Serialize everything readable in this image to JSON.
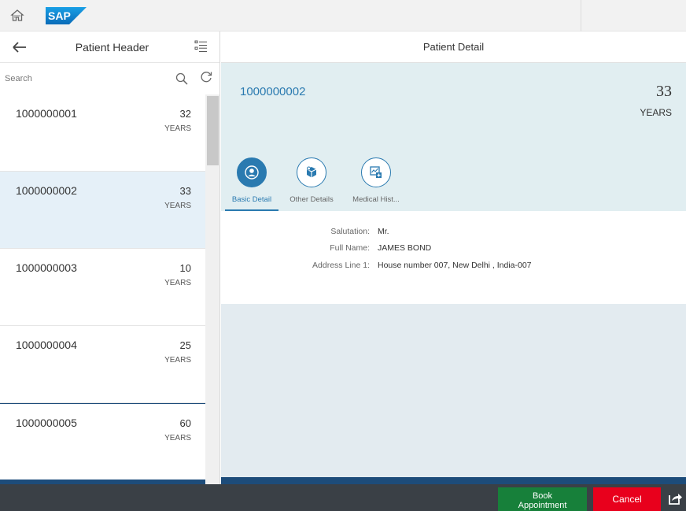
{
  "shell": {
    "logo_text": "SAP",
    "home_icon": "home-icon"
  },
  "master": {
    "title": "Patient Header",
    "search": {
      "placeholder": "Search",
      "value": ""
    },
    "unit_label": "YEARS",
    "items": [
      {
        "id": "1000000001",
        "age": "32",
        "unit": "YEARS"
      },
      {
        "id": "1000000002",
        "age": "33",
        "unit": "YEARS"
      },
      {
        "id": "1000000003",
        "age": "10",
        "unit": "YEARS"
      },
      {
        "id": "1000000004",
        "age": "25",
        "unit": "YEARS"
      },
      {
        "id": "1000000005",
        "age": "60",
        "unit": "YEARS"
      }
    ],
    "selected_index": 1
  },
  "detail": {
    "title": "Patient Detail",
    "object": {
      "id": "1000000002",
      "age": "33",
      "unit": "YEARS"
    },
    "tabs": [
      {
        "label": "Basic Detail",
        "icon": "person-icon"
      },
      {
        "label": "Other Details",
        "icon": "box-icon"
      },
      {
        "label": "Medical Hist...",
        "icon": "medical-chart-icon"
      }
    ],
    "fields": [
      {
        "label": "Salutation:",
        "value": "Mr."
      },
      {
        "label": "Full Name:",
        "value": "JAMES BOND"
      },
      {
        "label": "Address Line 1:",
        "value": "House number 007, New Delhi , India-007"
      }
    ]
  },
  "footer": {
    "book_label_1": "Book",
    "book_label_2": "Appointment",
    "cancel_label": "Cancel",
    "share_icon": "share-icon"
  },
  "colors": {
    "accent": "#2a7ab0",
    "selected_row": "#e5f0f8",
    "object_header": "#e1eef1",
    "footer": "#3a4046",
    "accept": "#17803a",
    "reject": "#e8001c",
    "dark_blue_bar": "#1d4c7a"
  }
}
